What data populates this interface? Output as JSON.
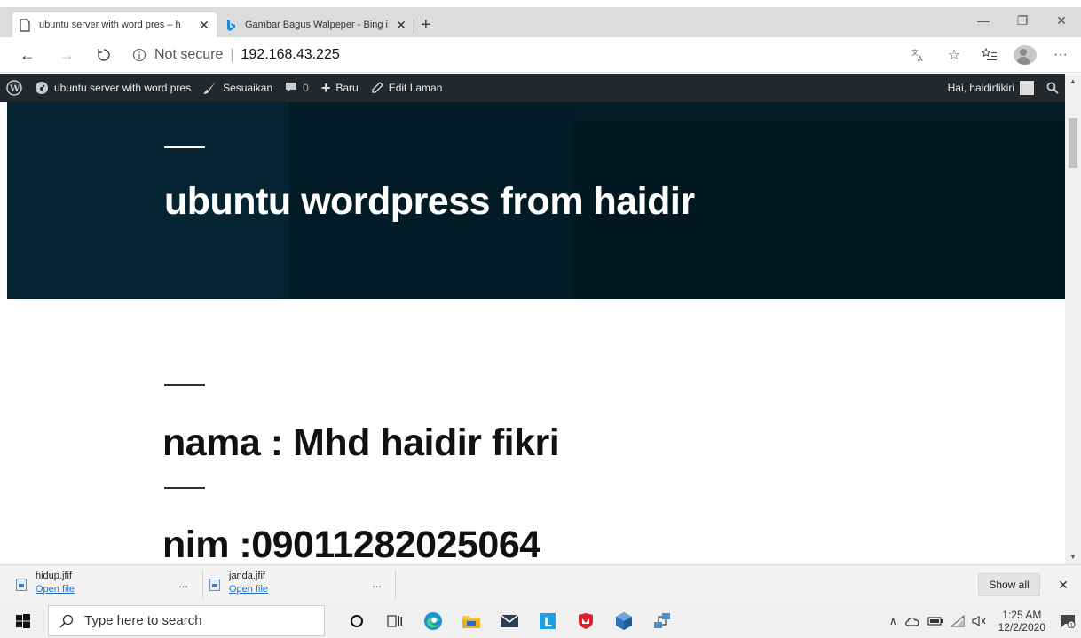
{
  "browser": {
    "tabs": [
      {
        "title": "ubuntu server with word pres – h",
        "active": true
      },
      {
        "title": "Gambar Bagus Walpeper - Bing i",
        "active": false
      }
    ],
    "address": {
      "security_label": "Not secure",
      "url": "192.168.43.225"
    }
  },
  "wp_adminbar": {
    "site_name": "ubuntu server with word pres",
    "customize": "Sesuaikan",
    "comments_count": "0",
    "new": "Baru",
    "edit_page": "Edit Laman",
    "greeting": "Hai, haidirfikiri"
  },
  "hero": {
    "site_title": "ubuntu wordpress from haidir"
  },
  "content": {
    "posts": [
      {
        "title": "nama : Mhd haidir fikri"
      },
      {
        "title": "nim :09011282025064"
      }
    ]
  },
  "downloads": {
    "items": [
      {
        "filename": "hidup.jfif",
        "action": "Open file"
      },
      {
        "filename": "janda.jfif",
        "action": "Open file"
      }
    ],
    "more": "...",
    "show_all": "Show all"
  },
  "taskbar": {
    "search_placeholder": "Type here to search",
    "time": "1:25 AM",
    "date": "12/2/2020"
  },
  "colors": {
    "hero_bg": "#031e29",
    "adminbar_bg": "#23282d",
    "link": "#1a6fd8"
  }
}
